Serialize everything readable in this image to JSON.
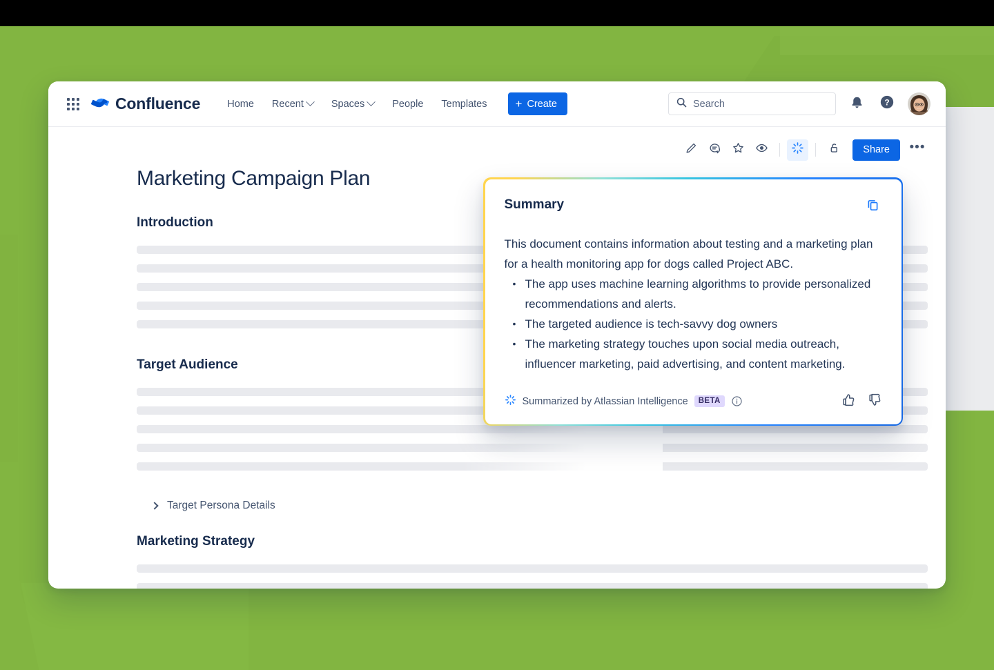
{
  "brand": {
    "name": "Confluence",
    "app_switcher_icon": "grid-apps-icon",
    "logo_icon": "confluence-logo-icon"
  },
  "nav": {
    "links": [
      {
        "label": "Home",
        "has_chevron": false
      },
      {
        "label": "Recent",
        "has_chevron": true
      },
      {
        "label": "Spaces",
        "has_chevron": true
      },
      {
        "label": "People",
        "has_chevron": false
      },
      {
        "label": "Templates",
        "has_chevron": false
      }
    ],
    "create_label": "Create",
    "create_plus": "+",
    "create_color": "#0c66e4"
  },
  "search": {
    "placeholder": "Search",
    "value": "",
    "icon": "search-icon"
  },
  "nav_right": {
    "notifications_icon": "bell-icon",
    "help_icon": "help-circle-icon",
    "avatar_icon": "user-avatar"
  },
  "page_toolbar": {
    "tools": [
      {
        "name": "edit-pencil-icon",
        "active": false
      },
      {
        "name": "comment-icon",
        "active": false
      },
      {
        "name": "star-icon",
        "active": false
      },
      {
        "name": "watch-eye-icon",
        "active": false
      },
      {
        "name": "atlassian-intelligence-icon",
        "active": true
      },
      {
        "name": "restrictions-lock-icon",
        "active": false
      }
    ],
    "share_label": "Share",
    "more_label": "•••",
    "active_highlight_color": "#e9f2ff"
  },
  "document": {
    "title": "Marketing Campaign Plan",
    "sections": [
      {
        "heading": "Introduction",
        "placeholder_lines": 5
      },
      {
        "heading": "Target Audience",
        "placeholder_lines": 5
      },
      {
        "heading": "Marketing Strategy",
        "placeholder_lines": 2
      }
    ],
    "expandable": {
      "label": "Target Persona Details",
      "icon": "chevron-right-icon",
      "expanded": false
    }
  },
  "summary_panel": {
    "title": "Summary",
    "copy_icon": "copy-icon",
    "lead": "This document contains information about testing and a marketing plan for a health monitoring app for dogs called Project ABC.",
    "bullets": [
      "The app uses machine learning algorithms to provide personalized recommendations and alerts.",
      "The targeted audience is tech-savvy dog owners",
      "The marketing strategy touches upon social media outreach, influencer marketing, paid advertising, and content marketing."
    ],
    "footer": {
      "ai_icon": "atlassian-intelligence-icon",
      "attribution": "Summarized by Atlassian Intelligence",
      "badge": "BETA",
      "info_icon": "info-circle-icon",
      "thumbs_up_icon": "thumbs-up-icon",
      "thumbs_down_icon": "thumbs-down-icon"
    },
    "border_gradient_from": "#ffd54f",
    "border_gradient_to": "#1668e3",
    "badge_color": "#dfd8fd"
  },
  "background": {
    "green": "#82b541",
    "gray_panel": "#ebecee",
    "top_bar": "#000000"
  }
}
